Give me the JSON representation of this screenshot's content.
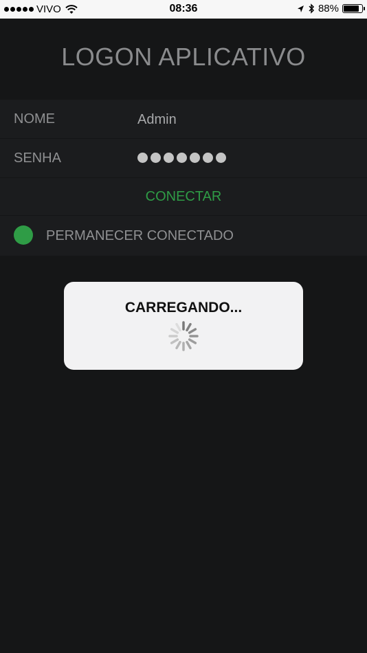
{
  "status_bar": {
    "carrier": "VIVO",
    "time": "08:36",
    "battery_percent": "88%",
    "battery_level": 0.88,
    "signal_bars": 5
  },
  "title": "LOGON APLICATIVO",
  "form": {
    "name_label": "NOME",
    "name_value": "Admin",
    "password_label": "SENHA",
    "password_length": 7,
    "connect_label": "CONECTAR",
    "stay_connected_label": "PERMANECER CONECTADO",
    "stay_connected_on": true
  },
  "loading_dialog": {
    "message": "CARREGANDO..."
  },
  "colors": {
    "background": "#151617",
    "accent": "#2f9c46"
  },
  "icons": [
    "wifi-icon",
    "location-arrow-icon",
    "bluetooth-icon",
    "battery-icon",
    "spinner-icon"
  ]
}
